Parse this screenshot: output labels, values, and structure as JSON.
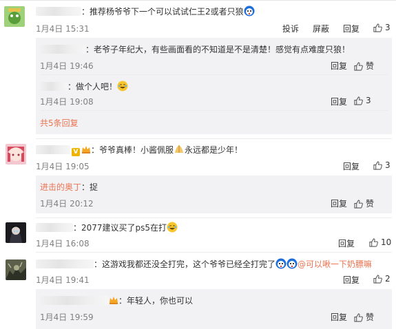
{
  "comments": [
    {
      "text": "：推荐杨爷爷下一个可以试试仁王2或者只狼",
      "time": "1月4日 15:31",
      "actions": [
        "投诉",
        "屏蔽",
        "回复"
      ],
      "likes": "3",
      "replies": [
        {
          "text": "：老爷子年纪大，有些画面看的不知道是不是清楚！感觉有点难度只狼！",
          "time": "1月4日 19:46",
          "reply_label": "回复",
          "like_label": "赞"
        },
        {
          "text": "：做个人吧！",
          "time": "1月4日 19:08",
          "reply_label": "回复",
          "likes": "3"
        }
      ],
      "more_replies": "共5条回复"
    },
    {
      "text_a": "：爷爷真棒！小酱佩服",
      "text_b": "永远都是少年！",
      "time": "1月4日 19:05",
      "reply_label": "回复",
      "likes": "3",
      "replies": [
        {
          "name": "进击的奥丁",
          "text": "：捉",
          "time": "1月4日 20:12",
          "reply_label": "回复",
          "like_label": "赞"
        }
      ]
    },
    {
      "text": "：2077建议买了ps5在打",
      "time": "1月4日 16:08",
      "reply_label": "回复",
      "likes": "10"
    },
    {
      "text": "：这游戏我都还没全打完，这个爷爷已经全打完了",
      "mention": "@可以啾一下奶膘嘛",
      "time": "1月4日 19:41",
      "reply_label": "回复",
      "likes": "2",
      "replies": [
        {
          "text": "：年轻人，你也可以",
          "time": "1月4日 19:59",
          "reply_label": "回复",
          "like_label": "赞"
        }
      ]
    }
  ],
  "colors": {
    "link": "#eb7350",
    "reply_bg": "#f2f2f5",
    "time": "#808080"
  }
}
